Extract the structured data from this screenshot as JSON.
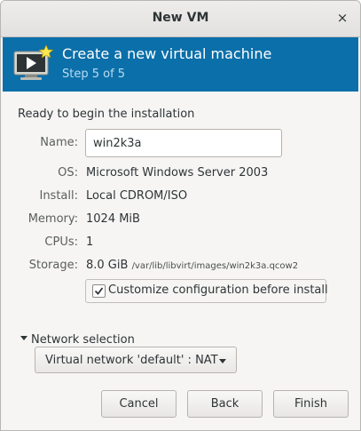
{
  "window": {
    "title": "New VM",
    "close_glyph": "×"
  },
  "banner": {
    "icon": "virtual-machine-monitor-icon",
    "heading": "Create a new virtual machine",
    "step": "Step 5 of 5",
    "background_color": "#0b6fa9"
  },
  "summary": {
    "section_title": "Ready to begin the installation",
    "name_label": "Name:",
    "name_value": "win2k3a",
    "os_label": "OS:",
    "os_value": "Microsoft Windows Server 2003",
    "install_label": "Install:",
    "install_value": "Local CDROM/ISO",
    "memory_label": "Memory:",
    "memory_value": "1024 MiB",
    "cpus_label": "CPUs:",
    "cpus_value": "1",
    "storage_label": "Storage:",
    "storage_size": "8.0 GiB",
    "storage_path": "/var/lib/libvirt/images/win2k3a.qcow2"
  },
  "customize": {
    "label": "Customize configuration before install",
    "checked": true
  },
  "network": {
    "expander_label": "Network selection",
    "expanded": true,
    "selected": "Virtual network 'default' : NAT"
  },
  "buttons": {
    "cancel": "Cancel",
    "back": "Back",
    "finish": "Finish"
  }
}
